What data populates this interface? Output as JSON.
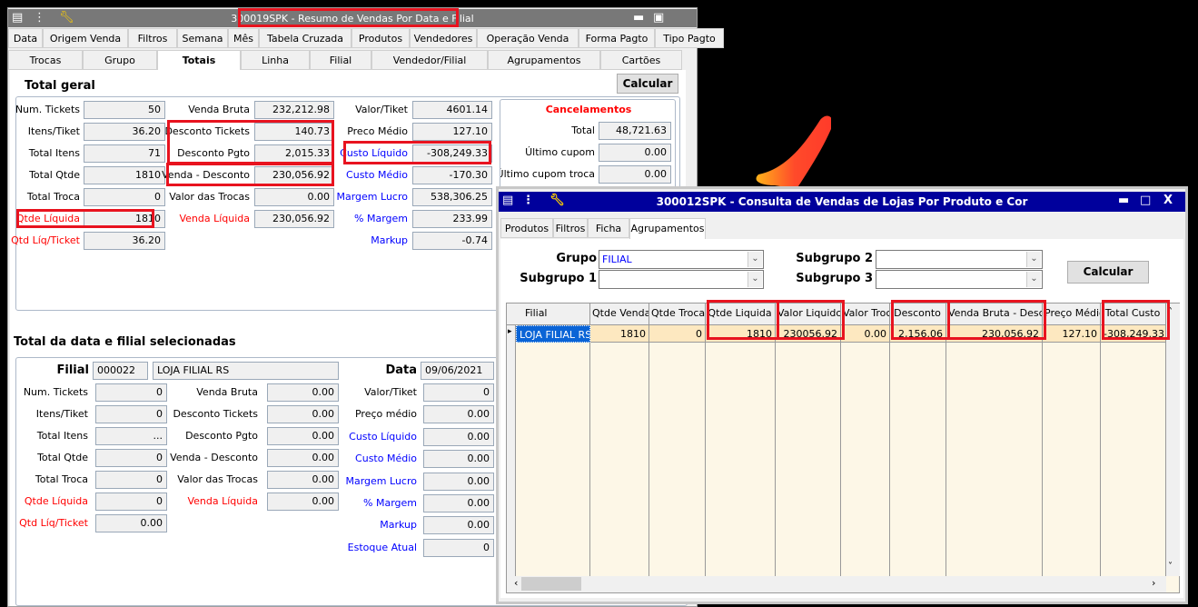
{
  "colors": {
    "accent_red": "#e8131f",
    "label_red": "#ff0000",
    "label_blue": "#0000ff",
    "win1_title_bg": "#787878",
    "win2_title_bg": "#00009c",
    "grid_row_bg": "#fde8c0",
    "grid_empty_bg": "#fdf7e7"
  },
  "win1": {
    "title": "300019SPK - Resumo de Vendas Por Data e Filial",
    "tabs_row1": [
      "Data",
      "Origem Venda",
      "Filtros",
      "Semana",
      "Mês",
      "Tabela  Cruzada",
      "Produtos",
      "Vendedores",
      "Operação Venda",
      "Forma Pagto",
      "Tipo Pagto"
    ],
    "tabs_row2": [
      "Trocas",
      "Grupo",
      "Totais",
      "Linha",
      "Filial",
      "Vendedor/Filial",
      "Agrupamentos",
      "Cartões"
    ],
    "active_tab": "Totais",
    "calc_label": "Calcular",
    "total_geral": {
      "title": "Total geral",
      "col1": [
        {
          "label": "Num. Tickets",
          "value": "50"
        },
        {
          "label": "Itens/Tiket",
          "value": "36.20"
        },
        {
          "label": "Total Itens",
          "value": "71"
        },
        {
          "label": "Total Qtde",
          "value": "1810"
        },
        {
          "label": "Total Troca",
          "value": "0"
        },
        {
          "label": "Qtde Líquida",
          "value": "1810",
          "color": "red"
        },
        {
          "label": "Qtd Líq/Ticket",
          "value": "36.20",
          "color": "red"
        }
      ],
      "col2": [
        {
          "label": "Venda Bruta",
          "value": "232,212.98"
        },
        {
          "label": "Desconto Tickets",
          "value": "140.73"
        },
        {
          "label": "Desconto Pgto",
          "value": "2,015.33"
        },
        {
          "label": "Venda - Desconto",
          "value": "230,056.92"
        },
        {
          "label": "Valor das Trocas",
          "value": "0.00"
        },
        {
          "label": "Venda Líquida",
          "value": "230,056.92",
          "color": "red"
        }
      ],
      "col3": [
        {
          "label": "Valor/Tiket",
          "value": "4601.14"
        },
        {
          "label": "Preco Médio",
          "value": "127.10"
        },
        {
          "label": "Custo Líquido",
          "value": "-308,249.33",
          "color": "blue"
        },
        {
          "label": "Custo Médio",
          "value": "-170.30",
          "color": "blue"
        },
        {
          "label": "Margem Lucro",
          "value": "538,306.25",
          "color": "blue"
        },
        {
          "label": "% Margem",
          "value": "233.99",
          "color": "blue"
        },
        {
          "label": "Markup",
          "value": "-0.74",
          "color": "blue"
        }
      ],
      "cancelamentos": {
        "title": "Cancelamentos",
        "rows": [
          {
            "label": "Total",
            "value": "48,721.63"
          },
          {
            "label": "Último cupom",
            "value": "0.00"
          },
          {
            "label": "Último cupom troca",
            "value": "0.00"
          }
        ]
      }
    },
    "selecionada": {
      "title": "Total da data e filial selecionadas",
      "filial_label": "Filial",
      "filial_code": "000022",
      "filial_name": "LOJA FILIAL RS",
      "data_label": "Data",
      "data_value": "09/06/2021",
      "col1": [
        {
          "label": "Num. Tickets",
          "value": "0"
        },
        {
          "label": "Itens/Tiket",
          "value": "0"
        },
        {
          "label": "Total Itens",
          "value": "..."
        },
        {
          "label": "Total Qtde",
          "value": "0"
        },
        {
          "label": "Total Troca",
          "value": "0"
        },
        {
          "label": "Qtde Líquida",
          "value": "0",
          "color": "red"
        },
        {
          "label": "Qtd Líq/Ticket",
          "value": "0.00",
          "color": "red"
        }
      ],
      "col2": [
        {
          "label": "Venda Bruta",
          "value": "0.00"
        },
        {
          "label": "Desconto Tickets",
          "value": "0.00"
        },
        {
          "label": "Desconto Pgto",
          "value": "0.00"
        },
        {
          "label": "Venda - Desconto",
          "value": "0.00"
        },
        {
          "label": "Valor das Trocas",
          "value": "0.00"
        },
        {
          "label": "Venda Líquida",
          "value": "0.00",
          "color": "red"
        }
      ],
      "col3": [
        {
          "label": "Valor/Tiket",
          "value": "0"
        },
        {
          "label": "Preço médio",
          "value": "0.00"
        },
        {
          "label": "Custo Líquido",
          "value": "0.00",
          "color": "blue"
        },
        {
          "label": "Custo Médio",
          "value": "0.00",
          "color": "blue"
        },
        {
          "label": "Margem Lucro",
          "value": "0.00",
          "color": "blue"
        },
        {
          "label": "% Margem",
          "value": "0.00",
          "color": "blue"
        },
        {
          "label": "Markup",
          "value": "0.00",
          "color": "blue"
        },
        {
          "label": "Estoque Atual",
          "value": "0",
          "color": "blue"
        }
      ]
    }
  },
  "win2": {
    "title": "300012SPK - Consulta de Vendas de Lojas Por Produto e Cor",
    "tabs": [
      "Produtos",
      "Filtros",
      "Ficha",
      "Agrupamentos"
    ],
    "active_tab": "Agrupamentos",
    "grupo_label": "Grupo",
    "grupo_value": "FILIAL",
    "subgrupo1_label": "Subgrupo 1",
    "subgrupo1_value": "",
    "subgrupo2_label": "Subgrupo 2",
    "subgrupo2_value": "",
    "subgrupo3_label": "Subgrupo 3",
    "subgrupo3_value": "",
    "calc_label": "Calcular",
    "grid": {
      "columns": [
        "Filial",
        "Qtde Venda",
        "Qtde Troca",
        "Qtde Liquida",
        "Valor Liquido",
        "Valor Troca",
        "Desconto",
        "Venda Bruta - Desc.",
        "Preço Médio",
        "Total Custo"
      ],
      "highlighted": [
        "Qtde Liquida",
        "Valor Liquido",
        "Desconto",
        "Venda Bruta - Desc.",
        "Total Custo"
      ],
      "rows": [
        [
          "LOJA FILIAL RS",
          "1810",
          "0",
          "1810",
          "230056.92",
          "0.00",
          "2,156.06",
          "230,056.92",
          "127.10",
          "-308,249.33"
        ]
      ]
    }
  }
}
